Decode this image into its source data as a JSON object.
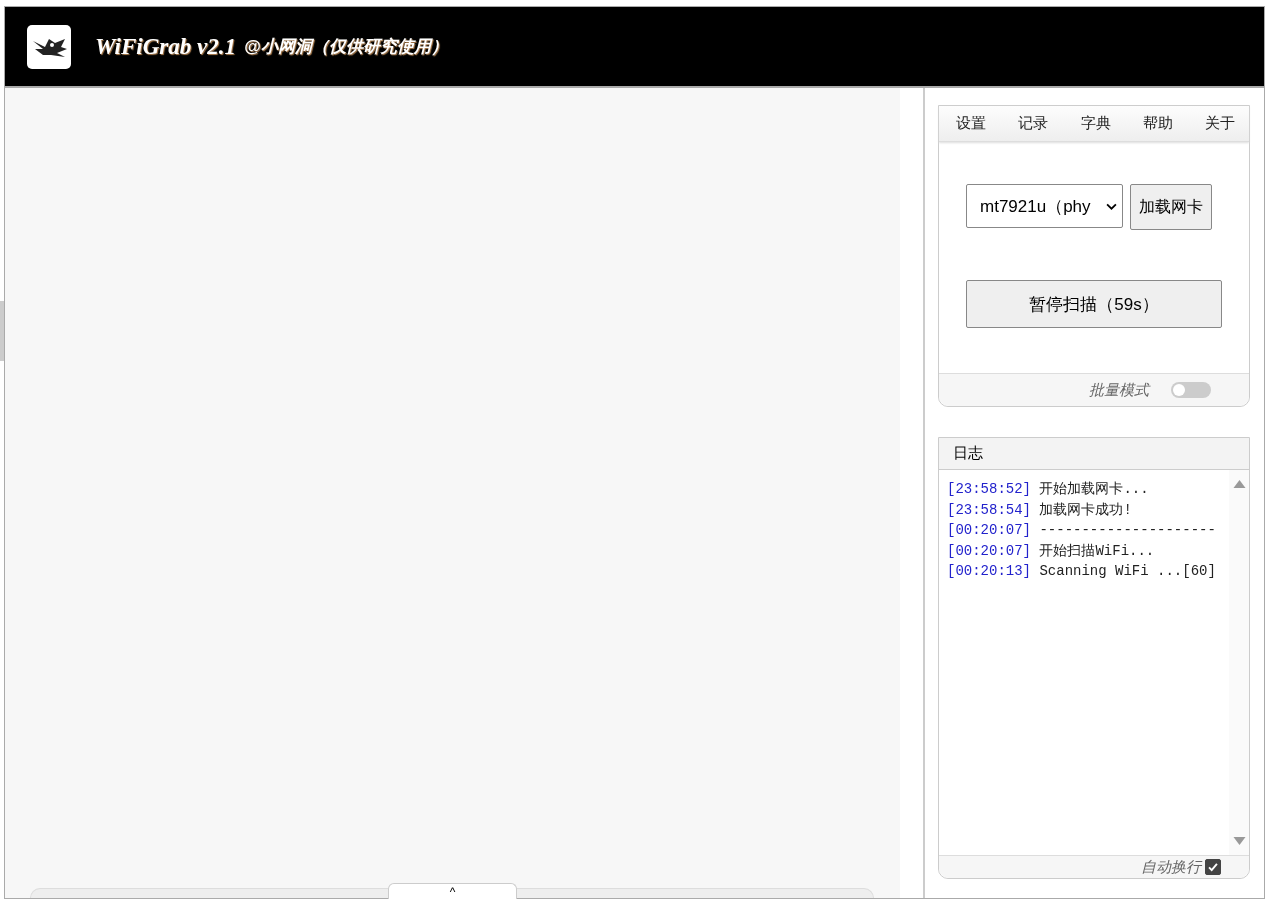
{
  "header": {
    "title": "WiFiGrab v2.1",
    "subtitle": "@小网洞（仅供研究使用）"
  },
  "menu": [
    {
      "label": "设置"
    },
    {
      "label": "记录"
    },
    {
      "label": "字典"
    },
    {
      "label": "帮助"
    },
    {
      "label": "关于"
    }
  ],
  "adapter_select": {
    "value": "mt7921u（phy"
  },
  "load_button": "加载网卡",
  "scan_button": "暂停扫描（59s）",
  "batch_mode": {
    "label": "批量模式",
    "on": false
  },
  "log": {
    "title": "日志",
    "lines": [
      {
        "time": "[23:58:52]",
        "message": "开始加载网卡..."
      },
      {
        "time": "[23:58:54]",
        "message": "加载网卡成功!"
      },
      {
        "time": "[00:20:07]",
        "message": "---------------------"
      },
      {
        "time": "[00:20:07]",
        "message": "开始扫描WiFi..."
      },
      {
        "time": "[00:20:13]",
        "message": "Scanning WiFi ...[60]"
      }
    ],
    "auto_wrap": {
      "label": "自动换行",
      "checked": true
    }
  },
  "bottom_drawer": {
    "handle": "^"
  }
}
